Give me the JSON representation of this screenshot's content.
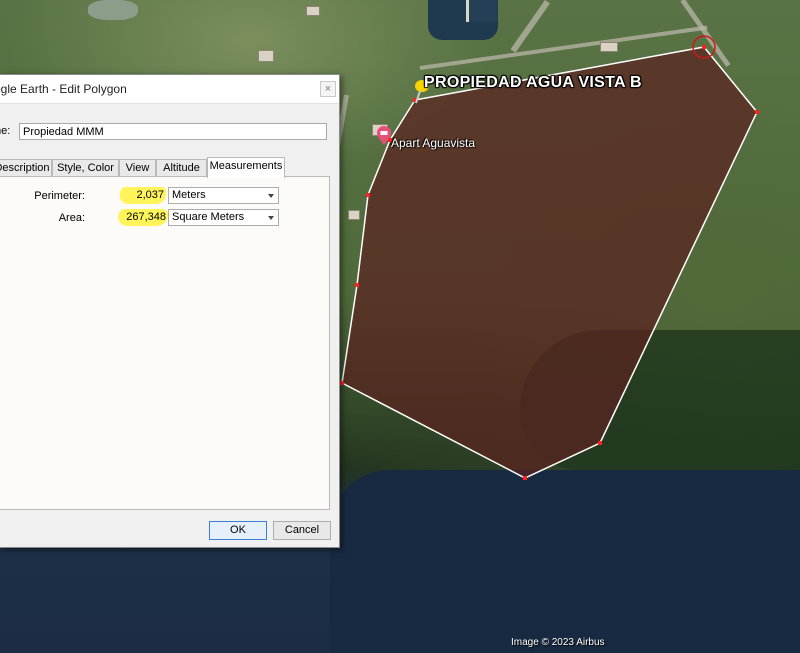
{
  "dialog": {
    "title": "ogle Earth - Edit Polygon",
    "close_glyph": "×",
    "name_label": "me:",
    "name_value": "Propiedad MMM",
    "tabs": [
      "Description",
      "Style, Color",
      "View",
      "Altitude",
      "Measurements"
    ],
    "active_tab": "Measurements",
    "measurements": {
      "perimeter_label": "Perimeter:",
      "perimeter_value": "2,037",
      "perimeter_unit": "Meters",
      "area_label": "Area:",
      "area_value": "267,348",
      "area_unit": "Square Meters",
      "highlight_color": "#fff55a"
    },
    "ok_label": "OK",
    "cancel_label": "Cancel"
  },
  "map": {
    "placemark_title": "PROPIEDAD AGUA VISTA B",
    "poi_label": "Apart Aguavista",
    "attribution": "Image © 2023 Airbus",
    "polygon_fill": "#5a2320",
    "polygon_stroke": "#ffffff",
    "vertex_color": "#ff2222",
    "pin_color": "#f7d400",
    "poi_color": "#e8507a"
  }
}
